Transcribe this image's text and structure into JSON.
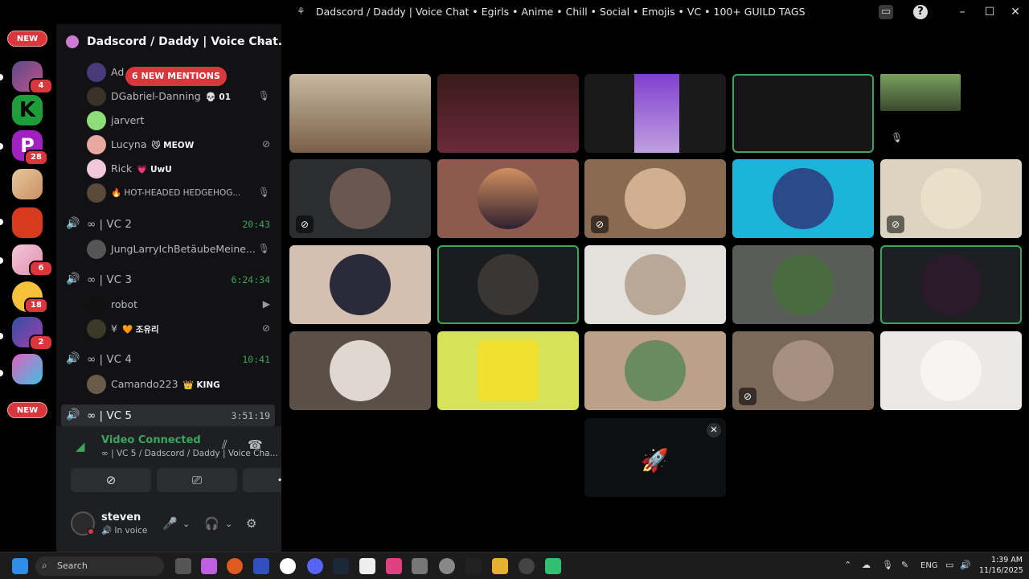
{
  "window": {
    "title": "Dadscord / Daddy | Voice Chat • Egirls • Anime • Chill • Social • Emojis • VC • 100+ GUILD TAGS"
  },
  "guilds": {
    "new_top": "NEW",
    "new_bottom": "NEW",
    "badges": [
      "4",
      "28",
      "6",
      "18",
      "2"
    ]
  },
  "server": {
    "name": "Dadscord / Daddy | Voice Chat...",
    "mentions_pill": "6 NEW MENTIONS"
  },
  "members_top": [
    {
      "name": "Ad",
      "tag": "",
      "status": ""
    },
    {
      "name": "DGabriel-Danning",
      "tag": "01",
      "status": "stream-icon"
    },
    {
      "name": "jarvert",
      "tag": "",
      "status": ""
    },
    {
      "name": "Lucyna",
      "tag": "MEOW",
      "status": "mic-muted-icon"
    },
    {
      "name": "Rick",
      "tag": "UwU",
      "status": ""
    },
    {
      "name": "🔥 HOT-HEADED HEDGEHOG...",
      "tag": "",
      "status": "stream-icon"
    }
  ],
  "voice_channels": [
    {
      "name": "∞ | VC 2",
      "time": "20:43",
      "members": [
        {
          "name": "JungLarryIchBetäubeMeine...",
          "tag": ""
        }
      ]
    },
    {
      "name": "∞ | VC 3",
      "time": "6:24:34",
      "members": [
        {
          "name": "robot",
          "tag": ""
        },
        {
          "name": "¥",
          "tag": "조유리"
        }
      ]
    },
    {
      "name": "∞ | VC 4",
      "time": "10:41",
      "members": [
        {
          "name": "Camando223",
          "tag": "KING"
        }
      ]
    },
    {
      "name": "∞ | VC 5",
      "time": "3:51:19",
      "members": []
    }
  ],
  "connection": {
    "status": "Video Connected",
    "channel": "∞ | VC 5 / Dadscord / Daddy | Voice Cha..."
  },
  "user": {
    "name": "steven",
    "status": "In voice"
  },
  "taskbar": {
    "search_placeholder": "Search",
    "lang": "ENG",
    "time": "1:39 AM",
    "date": "11/16/2025"
  },
  "colors": {
    "accent_green": "#3ba55d",
    "danger_red": "#da373c",
    "sidebar_bg": "#121214"
  }
}
